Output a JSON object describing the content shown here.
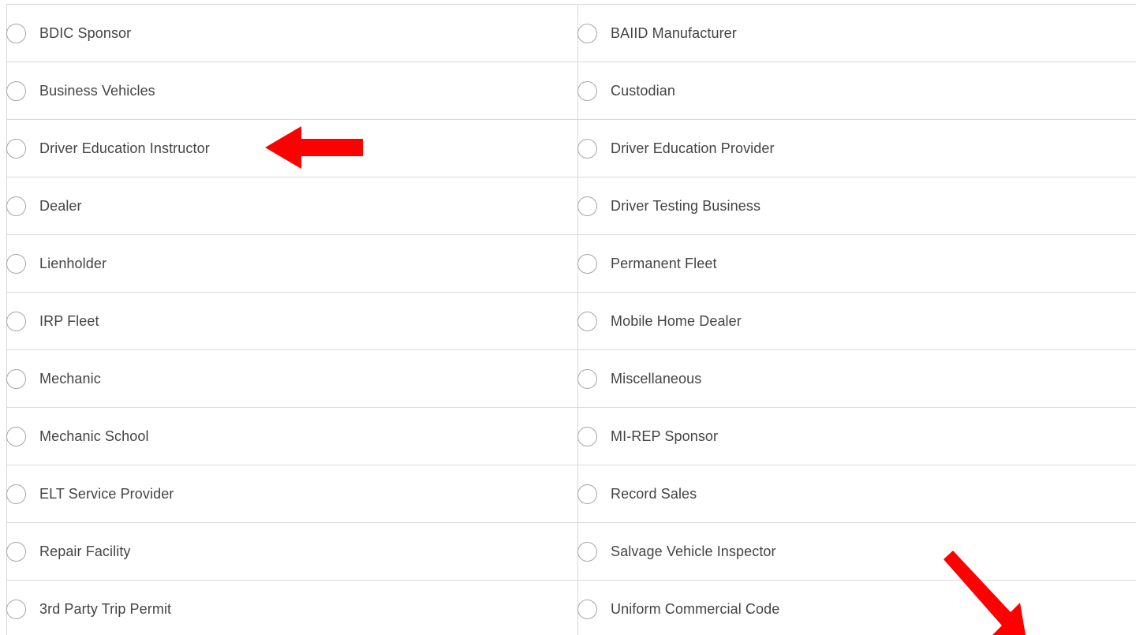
{
  "options": {
    "rows": [
      {
        "left": "BDIC Sponsor",
        "right": "BAIID Manufacturer"
      },
      {
        "left": "Business Vehicles",
        "right": "Custodian"
      },
      {
        "left": "Driver Education Instructor",
        "right": "Driver Education Provider"
      },
      {
        "left": "Dealer",
        "right": "Driver Testing Business"
      },
      {
        "left": "Lienholder",
        "right": "Permanent Fleet"
      },
      {
        "left": "IRP Fleet",
        "right": "Mobile Home Dealer"
      },
      {
        "left": "Mechanic",
        "right": "Miscellaneous"
      },
      {
        "left": "Mechanic School",
        "right": "MI-REP Sponsor"
      },
      {
        "left": "ELT Service Provider",
        "right": "Record Sales"
      },
      {
        "left": "Repair Facility",
        "right": "Salvage Vehicle Inspector"
      },
      {
        "left": "3rd Party Trip Permit",
        "right": "Uniform Commercial Code"
      }
    ]
  },
  "annotations": {
    "arrow_color": "#ff0000",
    "arrows": [
      "arrow-left-icon",
      "arrow-down-right-icon"
    ]
  },
  "colors": {
    "border": "#d9d9d9",
    "radio_border": "#a6a6a6",
    "text": "#444444"
  }
}
